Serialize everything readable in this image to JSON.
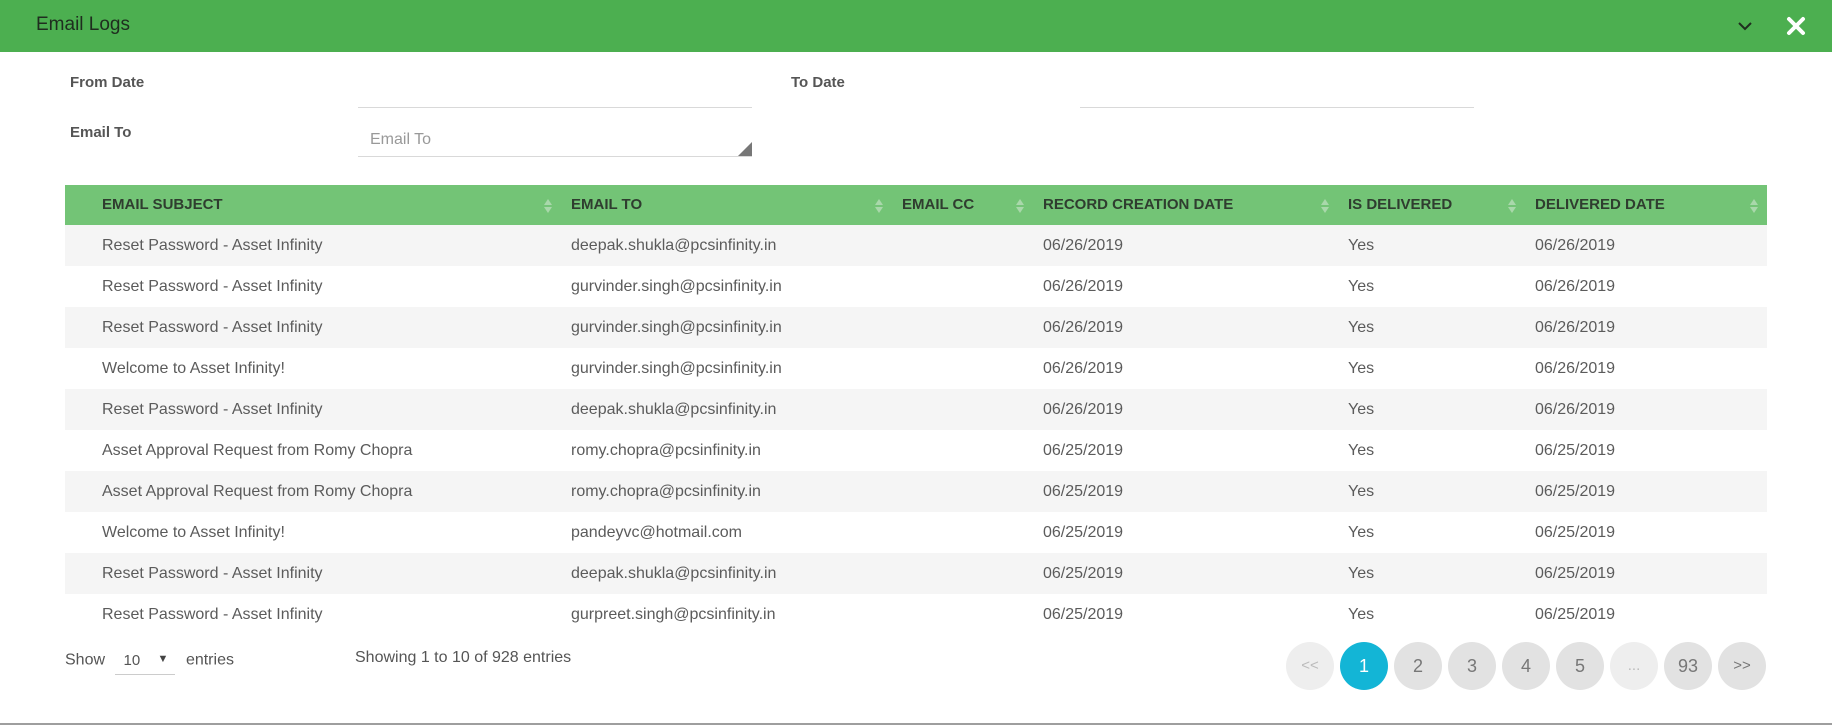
{
  "header": {
    "title": "Email Logs"
  },
  "filters": {
    "from_date_label": "From Date",
    "to_date_label": "To Date",
    "email_to_label": "Email To",
    "email_to_placeholder": "Email To",
    "from_date_value": "",
    "to_date_value": ""
  },
  "table": {
    "columns": [
      "EMAIL SUBJECT",
      "EMAIL TO",
      "EMAIL CC",
      "RECORD CREATION DATE",
      "IS DELIVERED",
      "DELIVERED DATE"
    ],
    "rows": [
      [
        "Reset Password - Asset Infinity",
        "deepak.shukla@pcsinfinity.in",
        "",
        "06/26/2019",
        "Yes",
        "06/26/2019"
      ],
      [
        "Reset Password - Asset Infinity",
        "gurvinder.singh@pcsinfinity.in",
        "",
        "06/26/2019",
        "Yes",
        "06/26/2019"
      ],
      [
        "Reset Password - Asset Infinity",
        "gurvinder.singh@pcsinfinity.in",
        "",
        "06/26/2019",
        "Yes",
        "06/26/2019"
      ],
      [
        "Welcome to Asset Infinity!",
        "gurvinder.singh@pcsinfinity.in",
        "",
        "06/26/2019",
        "Yes",
        "06/26/2019"
      ],
      [
        "Reset Password - Asset Infinity",
        "deepak.shukla@pcsinfinity.in",
        "",
        "06/26/2019",
        "Yes",
        "06/26/2019"
      ],
      [
        "Asset Approval Request from Romy Chopra",
        "romy.chopra@pcsinfinity.in",
        "",
        "06/25/2019",
        "Yes",
        "06/25/2019"
      ],
      [
        "Asset Approval Request from Romy Chopra",
        "romy.chopra@pcsinfinity.in",
        "",
        "06/25/2019",
        "Yes",
        "06/25/2019"
      ],
      [
        "Welcome to Asset Infinity!",
        "pandeyvc@hotmail.com",
        "",
        "06/25/2019",
        "Yes",
        "06/25/2019"
      ],
      [
        "Reset Password - Asset Infinity",
        "deepak.shukla@pcsinfinity.in",
        "",
        "06/25/2019",
        "Yes",
        "06/25/2019"
      ],
      [
        "Reset Password - Asset Infinity",
        "gurpreet.singh@pcsinfinity.in",
        "",
        "06/25/2019",
        "Yes",
        "06/25/2019"
      ]
    ]
  },
  "footer": {
    "show_label": "Show",
    "page_size": "10",
    "entries_label": "entries",
    "info": "Showing 1 to 10 of 928 entries"
  },
  "pagination": {
    "prev": "<<",
    "pages": [
      "1",
      "2",
      "3",
      "4",
      "5"
    ],
    "ellipsis": "...",
    "last": "93",
    "next": ">>",
    "active": "1"
  },
  "colors": {
    "header": "#4caf50",
    "table_header": "#73c476",
    "active_page": "#13b5d6"
  }
}
